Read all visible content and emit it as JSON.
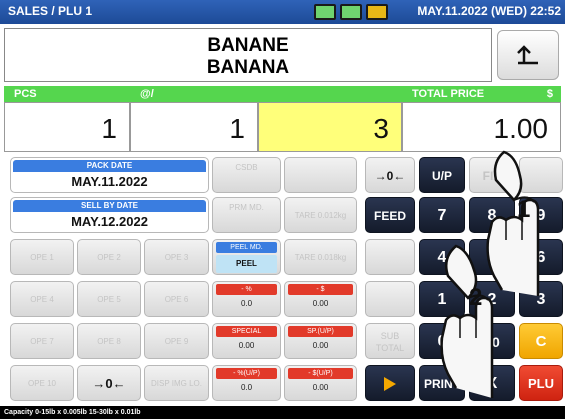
{
  "titlebar": {
    "title": "SALES / PLU 1",
    "datetime": "MAY.11.2022 (WED) 22:52"
  },
  "item": {
    "name_line1": "BANANE",
    "name_line2": "BANANA",
    "back_icon": "return-arrow-icon"
  },
  "fields": {
    "pcs": {
      "label": "PCS",
      "value": "1"
    },
    "unit_price": {
      "label": "@/",
      "value": "1"
    },
    "entry": {
      "label": "",
      "value": "3"
    },
    "total": {
      "label": "TOTAL PRICE",
      "currency": "$",
      "value": "1.00"
    }
  },
  "dates": {
    "pack_label": "PACK DATE",
    "pack_value": "MAY.11.2022",
    "sell_label": "SELL BY DATE",
    "sell_value": "MAY.12.2022"
  },
  "function_keys": {
    "csdb": "CSDB",
    "prm_md": "PRM MD.",
    "tare1": "TARE 0.012kg",
    "tare2": "TARE 0.018kg",
    "ope1": "OPE 1",
    "ope2": "OPE 2",
    "ope3": "OPE 3",
    "ope4": "OPE 4",
    "ope5": "OPE 5",
    "ope6": "OPE 6",
    "ope7": "OPE 7",
    "ope8": "OPE 8",
    "ope9": "OPE 9",
    "ope10": "OPE 10",
    "disp_img": "DISP IMG LO.",
    "zero": "→0←",
    "sub_total_1": "SUB",
    "sub_total_2": "TOTAL"
  },
  "peel": {
    "label": "PEEL MD.",
    "value": "PEEL"
  },
  "discounts": {
    "pct": {
      "label": "- %",
      "value": "0.0"
    },
    "amt": {
      "label": "- $",
      "value": "0.00"
    },
    "special": {
      "label": "SPECIAL",
      "value": "0.00"
    },
    "sp_up": {
      "label": "SP.(U/P)",
      "value": "0.00"
    },
    "pct_up": {
      "label": "- %(U/P)",
      "value": "0.0"
    },
    "amt_up": {
      "label": "- $(U/P)",
      "value": "0.00"
    }
  },
  "keypad": {
    "zero_key": "→0←",
    "up": "U/P",
    "fix": "FIX",
    "feed": "FEED",
    "k7": "7",
    "k8": "8",
    "k9": "9",
    "k4": "4",
    "k5": "5",
    "k6": "6",
    "k1": "1",
    "k2": "2",
    "k3": "3",
    "k0": "0",
    "k00": "00",
    "clear": "C",
    "play_icon": "play-icon",
    "print": "PRINT",
    "x": "X",
    "plu": "PLU"
  },
  "annotations": {
    "hand1": "1",
    "hand2": "2"
  },
  "status": "Capacity 0-15lb x 0.005lb  15-30lb x 0.01lb",
  "colors": {
    "title_blue": "#1d4a97",
    "green": "#55d64e",
    "yellow": "#ffff7a",
    "orange": "#f5a800",
    "red": "#dd2a14"
  }
}
